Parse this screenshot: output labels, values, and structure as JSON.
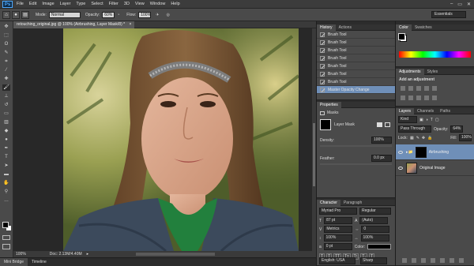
{
  "app": {
    "logo": "Ps"
  },
  "menu": [
    "File",
    "Edit",
    "Image",
    "Layer",
    "Type",
    "Select",
    "Filter",
    "3D",
    "View",
    "Window",
    "Help"
  ],
  "window_controls": [
    "–",
    "▭",
    "✕"
  ],
  "options": {
    "mode_label": "Mode:",
    "mode_value": "Normal",
    "opacity_label": "Opacity:",
    "opacity_value": "60%",
    "flow_label": "Flow:",
    "flow_value": "100%",
    "workspace": "Essentials"
  },
  "document": {
    "tab_title": "retouching_original.jpg @ 100% (Airbrushing, Layer Mask/8) *",
    "zoom": "100%",
    "doc_size": "Doc: 2.13M/4.40M"
  },
  "bottom_tabs": [
    "Mini Bridge",
    "Timeline"
  ],
  "history": {
    "tabs": [
      "History",
      "Actions"
    ],
    "items": [
      "Brush Tool",
      "Brush Tool",
      "Brush Tool",
      "Brush Tool",
      "Brush Tool",
      "Brush Tool",
      "Brush Tool",
      "Master Opacity Change"
    ]
  },
  "properties": {
    "tab": "Properties",
    "section": "Masks",
    "mask_label": "Layer Mask",
    "density_label": "Density:",
    "density_value": "100%",
    "feather_label": "Feather:",
    "feather_value": "0.0 px"
  },
  "character": {
    "tabs": [
      "Character",
      "Paragraph"
    ],
    "font": "Myriad Pro",
    "style": "Regular",
    "size": "87 pt",
    "leading": "(Auto)",
    "kerning": "Metrics",
    "tracking": "0",
    "vscale": "100%",
    "hscale": "100%",
    "baseline": "0 pt",
    "color_label": "Color:",
    "language": "English: USA",
    "antialias": "Sharp"
  },
  "color_panel": {
    "tabs": [
      "Color",
      "Swatches"
    ]
  },
  "adjustments": {
    "tabs": [
      "Adjustments",
      "Styles"
    ],
    "hint": "Add an adjustment"
  },
  "layers": {
    "tabs": [
      "Layers",
      "Channels",
      "Paths"
    ],
    "kind": "Kind",
    "blend": "Pass Through",
    "opacity_label": "Opacity:",
    "opacity_value": "64%",
    "lock_label": "Lock:",
    "fill_label": "Fill:",
    "fill_value": "100%",
    "items": [
      {
        "name": "Airbrushing"
      },
      {
        "name": "Original Image"
      }
    ]
  },
  "colors": {
    "accent_selection": "#6f8fb8",
    "panel_bg": "#4a4a4a",
    "app_bg": "#282828"
  }
}
